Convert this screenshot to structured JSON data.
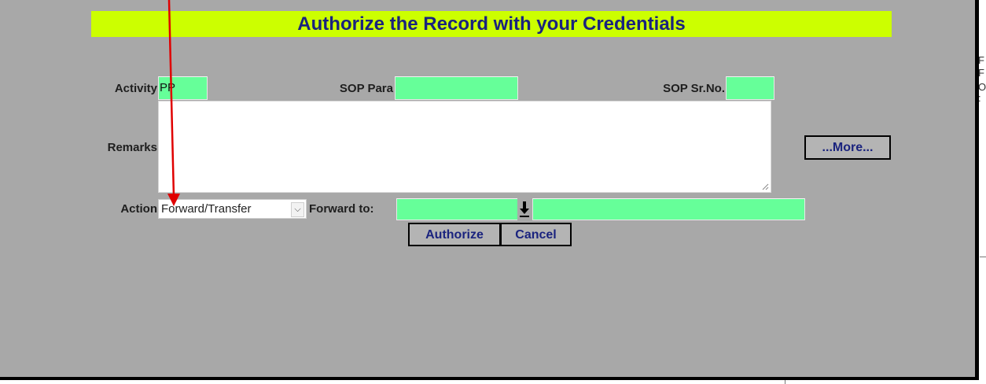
{
  "dialog": {
    "title": "Authorize the Record with your Credentials",
    "colors": {
      "title_bg": "#ccff00",
      "title_text": "#1a237e",
      "dialog_bg": "#a8a8a8",
      "field_bg": "#66ff99",
      "annotation": "#e00000"
    }
  },
  "form": {
    "activity": {
      "label": "Activity",
      "value": "PP"
    },
    "sop_para": {
      "label": "SOP Para",
      "value": ""
    },
    "sop_srno": {
      "label": "SOP Sr.No.",
      "value": ""
    },
    "remarks": {
      "label": "Remarks",
      "value": ""
    },
    "action": {
      "label": "Action",
      "selected": "Forward/Transfer"
    },
    "forward_to": {
      "label": "Forward to:",
      "code_value": "",
      "name_value": "",
      "lookup_icon": "download-arrow-icon"
    }
  },
  "buttons": {
    "more": "...More...",
    "authorize": "Authorize",
    "cancel": "Cancel"
  },
  "annotation": {
    "icon": "red-arrow-icon"
  }
}
